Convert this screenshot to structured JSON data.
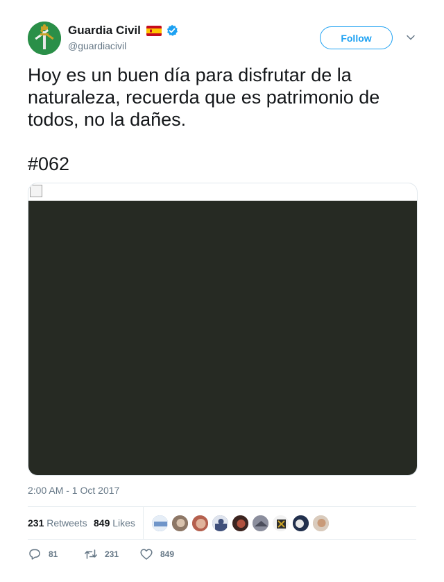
{
  "account": {
    "display_name": "Guardia Civil",
    "handle": "@guardiacivil",
    "avatar_icon": "guardia-civil-emblem",
    "flag_icon": "spain-flag",
    "verified_icon": "verified-badge",
    "colors": {
      "avatar_bg": "#2a8f48",
      "verified": "#1da1f2"
    }
  },
  "header": {
    "follow_label": "Follow",
    "menu_icon": "chevron-down-icon"
  },
  "tweet": {
    "text": "Hoy es un buen día para disfrutar de la naturaleza, recuerda que es patrimonio de todos, no la dañes.\n\n#062",
    "timestamp": "2:00 AM - 1 Oct 2017"
  },
  "stats": {
    "retweets_count": "231",
    "retweets_label": "Retweets",
    "likes_count": "849",
    "likes_label": "Likes"
  },
  "likers": [
    {
      "icon": "liker-avatar"
    },
    {
      "icon": "liker-avatar"
    },
    {
      "icon": "liker-avatar"
    },
    {
      "icon": "liker-avatar"
    },
    {
      "icon": "liker-avatar"
    },
    {
      "icon": "liker-avatar"
    },
    {
      "icon": "liker-avatar"
    },
    {
      "icon": "liker-avatar"
    },
    {
      "icon": "liker-avatar"
    }
  ],
  "actions": {
    "reply_count": "81",
    "retweet_count": "231",
    "like_count": "849"
  },
  "colors": {
    "accent": "#1da1f2",
    "muted": "#657786",
    "text": "#14171a",
    "video_bg": "#262a23"
  }
}
